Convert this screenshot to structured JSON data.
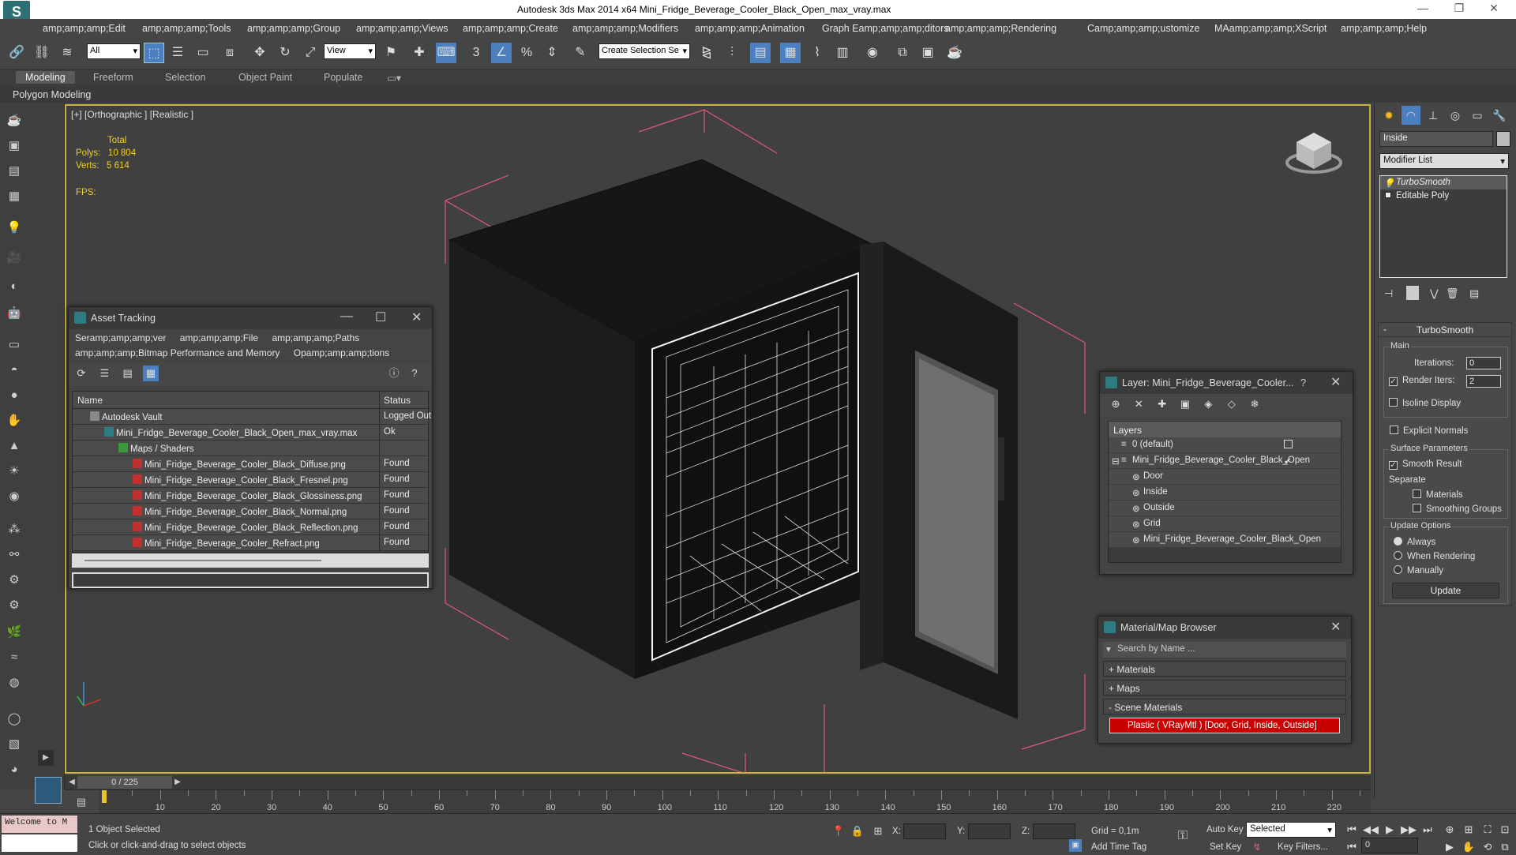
{
  "window": {
    "title": "Autodesk 3ds Max  2014 x64     Mini_Fridge_Beverage_Cooler_Black_Open_max_vray.max"
  },
  "menu": [
    "amp;amp;amp;Edit",
    "amp;amp;amp;Tools",
    "amp;amp;amp;Group",
    "amp;amp;amp;Views",
    "amp;amp;amp;Create",
    "amp;amp;amp;Modifiers",
    "amp;amp;amp;Animation",
    "Graph Eamp;amp;amp;ditors",
    "amp;amp;amp;Rendering",
    "Camp;amp;amp;ustomize",
    "MAamp;amp;amp;XScript",
    "amp;amp;amp;Help"
  ],
  "toolbar": {
    "filter_select": "All",
    "view_select": "View",
    "selection_set": "Create Selection Se"
  },
  "ribbon": {
    "tabs": [
      "Modeling",
      "Freeform",
      "Selection",
      "Object Paint",
      "Populate"
    ],
    "active": "Modeling",
    "sub": "Polygon Modeling"
  },
  "viewport": {
    "label": "[+] [Orthographic ] [Realistic ]",
    "stats_total": "Total",
    "polys_label": "Polys:",
    "polys_value": "10 804",
    "verts_label": "Verts:",
    "verts_value": "5 614",
    "fps_label": "FPS:"
  },
  "asset_tracking": {
    "title": "Asset Tracking",
    "menu_row1": [
      "Seramp;amp;amp;ver",
      "amp;amp;amp;File",
      "amp;amp;amp;Paths"
    ],
    "menu_row2": [
      "amp;amp;amp;Bitmap Performance and Memory",
      "Opamp;amp;amp;tions"
    ],
    "col_name": "Name",
    "col_status": "Status",
    "rows": [
      {
        "name": "Autodesk Vault",
        "status": "Logged Out"
      },
      {
        "name": "Mini_Fridge_Beverage_Cooler_Black_Open_max_vray.max",
        "status": "Ok"
      },
      {
        "name": "Maps / Shaders",
        "status": ""
      },
      {
        "name": "Mini_Fridge_Beverage_Cooler_Black_Diffuse.png",
        "status": "Found"
      },
      {
        "name": "Mini_Fridge_Beverage_Cooler_Black_Fresnel.png",
        "status": "Found"
      },
      {
        "name": "Mini_Fridge_Beverage_Cooler_Black_Glossiness.png",
        "status": "Found"
      },
      {
        "name": "Mini_Fridge_Beverage_Cooler_Black_Normal.png",
        "status": "Found"
      },
      {
        "name": "Mini_Fridge_Beverage_Cooler_Black_Reflection.png",
        "status": "Found"
      },
      {
        "name": "Mini_Fridge_Beverage_Cooler_Refract.png",
        "status": "Found"
      }
    ]
  },
  "layer_window": {
    "title": "Layer: Mini_Fridge_Beverage_Cooler...",
    "help": "?",
    "header": "Layers",
    "items": [
      "0 (default)",
      "Mini_Fridge_Beverage_Cooler_Black_Open",
      "Door",
      "Inside",
      "Outside",
      "Grid",
      "Mini_Fridge_Beverage_Cooler_Black_Open"
    ]
  },
  "material_browser": {
    "title": "Material/Map Browser",
    "search_placeholder": "Search by Name ...",
    "sections": [
      "+ Materials",
      "+ Maps",
      "- Scene Materials"
    ],
    "item": "Plastic  ( VRayMtl )  [Door, Grid, Inside, Outside]"
  },
  "command_panel": {
    "object_name": "Inside",
    "modifier_list": "Modifier List",
    "stack": [
      "TurboSmooth",
      "Editable Poly"
    ],
    "rollout_title": "TurboSmooth",
    "main_label": "Main",
    "iterations_label": "Iterations:",
    "iterations_value": "0",
    "render_iters_label": "Render Iters:",
    "render_iters_value": "2",
    "isoline": "Isoline Display",
    "explicit_normals": "Explicit Normals",
    "surface_params": "Surface Parameters",
    "smooth_result": "Smooth Result",
    "separate": "Separate",
    "materials": "Materials",
    "smoothing_groups": "Smoothing Groups",
    "update_options": "Update Options",
    "always": "Always",
    "when_rendering": "When Rendering",
    "manually": "Manually",
    "update_button": "Update"
  },
  "timeline": {
    "frame": "0 / 225",
    "ticks": [
      "10",
      "20",
      "30",
      "40",
      "50",
      "60",
      "70",
      "80",
      "90",
      "100",
      "110",
      "120",
      "130",
      "140",
      "150",
      "160",
      "170",
      "180",
      "190",
      "200",
      "210",
      "220"
    ]
  },
  "status": {
    "maxscript": "Welcome to M",
    "selected": "1 Object Selected",
    "prompt": "Click or click-and-drag to select objects",
    "x_label": "X:",
    "y_label": "Y:",
    "z_label": "Z:",
    "grid": "Grid = 0,1m",
    "add_time_tag": "Add Time Tag",
    "auto_key": "Auto Key",
    "key_select": "Selected",
    "set_key": "Set Key",
    "key_filters": "Key Filters...",
    "frame_field": "0"
  },
  "colors": {
    "viewport_border": "#c9b243",
    "stats_text": "#f2d11f",
    "material_highlight": "#c80000"
  }
}
